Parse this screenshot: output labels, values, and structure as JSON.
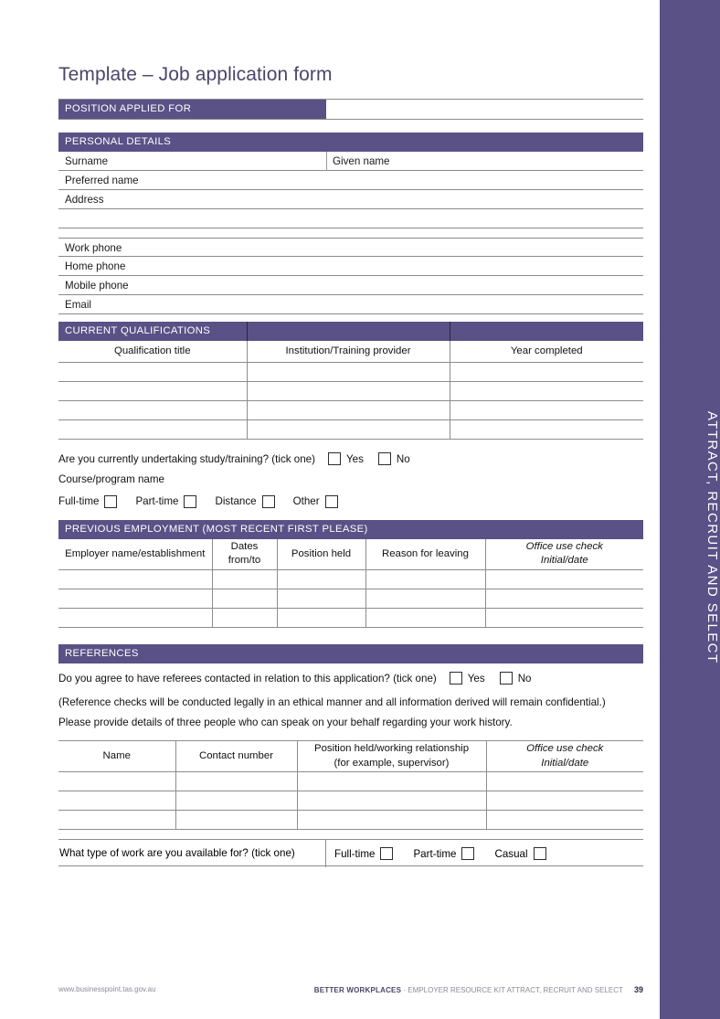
{
  "document": {
    "title": "Template – Job application form",
    "side_tab_label": "ATTRACT, RECRUIT AND SELECT",
    "accent_color": "#5a5186",
    "title_color": "#4a4668"
  },
  "position_applied": {
    "bar_label": "POSITION APPLIED FOR",
    "value": ""
  },
  "personal_details": {
    "bar_label": "PERSONAL DETAILS",
    "surname_label": "Surname",
    "given_name_label": "Given name",
    "preferred_name_label": "Preferred name",
    "address_label": "Address",
    "work_phone_label": "Work phone",
    "home_phone_label": "Home phone",
    "mobile_phone_label": "Mobile phone",
    "email_label": "Email"
  },
  "qualifications": {
    "bar_label": "CURRENT QUALIFICATIONS",
    "columns": [
      "Qualification title",
      "Institution/Training provider",
      "Year completed"
    ],
    "rows": [
      [
        "",
        "",
        ""
      ],
      [
        "",
        "",
        ""
      ],
      [
        "",
        "",
        ""
      ],
      [
        "",
        "",
        ""
      ]
    ]
  },
  "study": {
    "question": "Are you currently undertaking study/training? (tick one)",
    "yes_label": "Yes",
    "no_label": "No",
    "course_label": "Course/program name",
    "mode_options": [
      "Full-time",
      "Part-time",
      "Distance",
      "Other"
    ]
  },
  "previous_employment": {
    "bar_label": "PREVIOUS EMPLOYMENT (MOST RECENT FIRST PLEASE)",
    "columns": [
      "Employer name/establishment",
      "Dates\nfrom/to",
      "Position held",
      "Reason for leaving",
      "Office use check\nInitial/date"
    ],
    "col_employer": "Employer name/establishment",
    "col_dates_line1": "Dates",
    "col_dates_line2": "from/to",
    "col_position": "Position held",
    "col_reason": "Reason for leaving",
    "col_office_line1": "Office use check",
    "col_office_line2": "Initial/date",
    "rows": [
      [
        "",
        "",
        "",
        "",
        ""
      ],
      [
        "",
        "",
        "",
        "",
        ""
      ],
      [
        "",
        "",
        "",
        "",
        ""
      ]
    ]
  },
  "references": {
    "bar_label": "REFERENCES",
    "consent_question": "Do you agree to have referees contacted in relation to this application? (tick one)",
    "yes_label": "Yes",
    "no_label": "No",
    "note_line1": "(Reference checks will be conducted legally in an ethical manner and all information derived will remain confidential.)",
    "note_line2": "Please provide details of three people who can speak on your behalf regarding your work history.",
    "col_name": "Name",
    "col_contact": "Contact number",
    "col_position_line1": "Position held/working relationship",
    "col_position_line2": "(for example, supervisor)",
    "col_office_line1": "Office use check",
    "col_office_line2": "Initial/date",
    "rows": [
      [
        "",
        "",
        "",
        ""
      ],
      [
        "",
        "",
        "",
        ""
      ],
      [
        "",
        "",
        "",
        ""
      ]
    ]
  },
  "availability": {
    "question": "What type of work are you available for? (tick one)",
    "options": [
      "Full-time",
      "Part-time",
      "Casual"
    ]
  },
  "footer": {
    "website": "www.businesspoint.tas.gov.au",
    "brand": "BETTER WORKPLACES",
    "separator": "·",
    "kit": "EMPLOYER RESOURCE KIT ATTRACT, RECRUIT AND SELECT",
    "page_number": "39"
  }
}
